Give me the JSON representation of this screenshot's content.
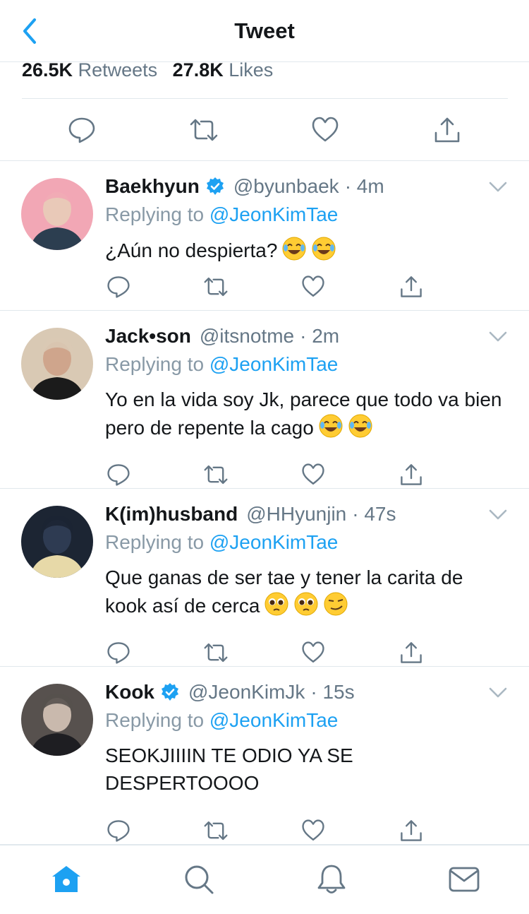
{
  "header": {
    "title": "Tweet"
  },
  "stats": {
    "retweets_count": "26.5K",
    "retweets_label": "Retweets",
    "likes_count": "27.8K",
    "likes_label": "Likes"
  },
  "replies": [
    {
      "name": "Baekhyun",
      "verified": true,
      "handle": "@byunbaek",
      "time": "· 4m",
      "replying_prefix": "Replying to",
      "replying_to": "@JeonKimTae",
      "text": "¿Aún no despierta?",
      "emojis": [
        "face-with-tears-of-joy",
        "face-with-tears-of-joy"
      ]
    },
    {
      "name": "Jack•son",
      "verified": false,
      "handle": "@itsnotme",
      "time": "· 2m",
      "replying_prefix": "Replying to",
      "replying_to": "@JeonKimTae",
      "text": "Yo en la vida soy Jk, parece que todo va bien pero de repente la cago",
      "emojis": [
        "face-with-tears-of-joy",
        "face-with-tears-of-joy"
      ]
    },
    {
      "name": "K(im)husband",
      "verified": false,
      "handle": "@HHyunjin",
      "time": "· 47s",
      "replying_prefix": "Replying to",
      "replying_to": "@JeonKimTae",
      "text": "Que ganas de ser tae y tener la carita de kook así de cerca",
      "emojis": [
        "pleading-face",
        "pleading-face",
        "smirking-face"
      ]
    },
    {
      "name": "Kook",
      "verified": true,
      "handle": "@JeonKimJk",
      "time": "· 15s",
      "replying_prefix": "Replying to",
      "replying_to": "@JeonKimTae",
      "text": "SEOKJIIIIN TE ODIO YA SE DESPERTOOOO",
      "emojis": []
    }
  ],
  "tabbar": [
    "home-icon",
    "search-icon",
    "notifications-icon",
    "messages-icon"
  ],
  "colors": {
    "accent": "#1da1f2",
    "secondary_text": "#657786",
    "divider": "#e1e8ed"
  }
}
